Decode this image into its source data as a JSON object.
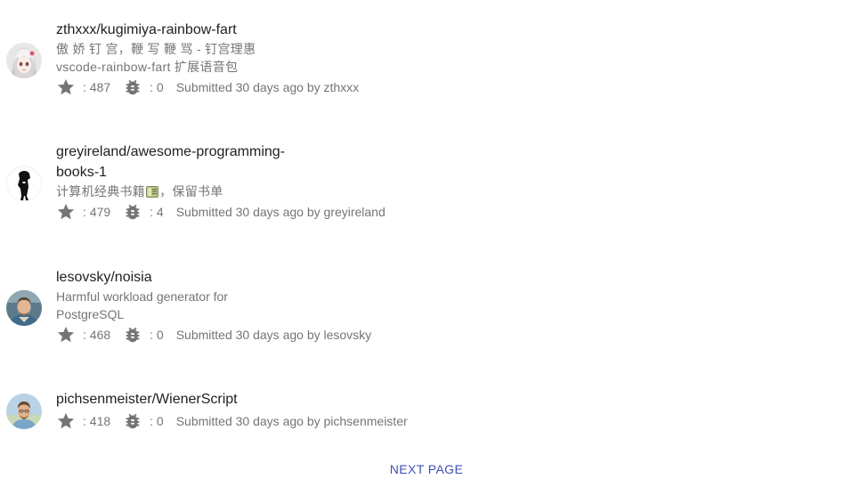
{
  "repos": [
    {
      "name": "zthxxx/kugimiya-rainbow-fart",
      "description_lines": [
        "傲 娇 钉 宫，鞭 写 鞭 骂 - 钉宫理惠",
        "vscode-rainbow-fart 扩展语音包"
      ],
      "star_label": ": 487",
      "issue_label": ": 0",
      "submitted": "Submitted 30 days ago by zthxxx",
      "avatar_icon": "anime-girl-avatar"
    },
    {
      "name": "greyireland/awesome-programming-books-1",
      "description_before_emoji": "计算机经典书籍",
      "description_emoji": "ledger-emoji",
      "description_after_emoji": "，保留书单",
      "star_label": ": 479",
      "issue_label": ": 4",
      "submitted": "Submitted 30 days ago by greyireland",
      "avatar_icon": "dark-figure-avatar"
    },
    {
      "name": "lesovsky/noisia",
      "description": "Harmful workload generator for PostgreSQL",
      "star_label": ": 468",
      "issue_label": ": 0",
      "submitted": "Submitted 30 days ago by lesovsky",
      "avatar_icon": "man-photo-avatar"
    },
    {
      "name": "pichsenmeister/WienerScript",
      "star_label": ": 418",
      "issue_label": ": 0",
      "submitted": "Submitted 30 days ago by pichsenmeister",
      "avatar_icon": "man-outdoor-photo-avatar"
    }
  ],
  "pagination": {
    "next_label": "NEXT PAGE"
  },
  "colors": {
    "title": "#212121",
    "secondary": "#757575",
    "icon": "#757575",
    "link": "#3f51b5"
  }
}
